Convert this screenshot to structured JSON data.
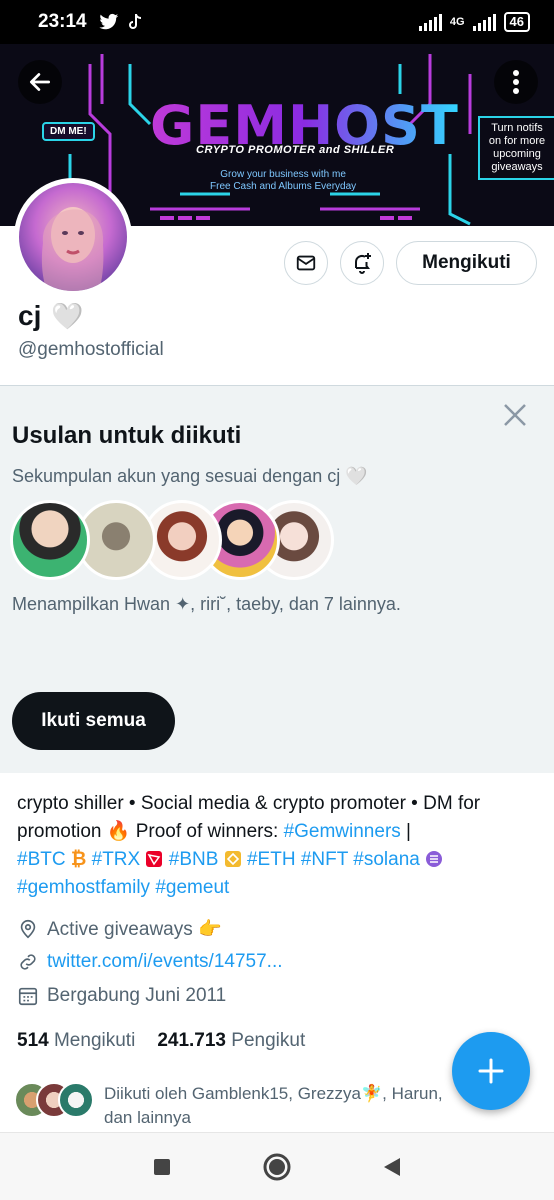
{
  "status_bar": {
    "time": "23:14",
    "network": "4G",
    "battery": "46",
    "notification_icons": [
      "twitter-icon",
      "tiktok-icon"
    ]
  },
  "banner": {
    "title": "GEMHOST",
    "subtitle": "CRYPTO PROMOTER and SHILLER",
    "tagline_line1": "Grow your business with me",
    "tagline_line2": "Free Cash and Albums Everyday",
    "dm_badge": "DM ME!",
    "notifs_text": "Turn notifs on for more upcoming giveaways"
  },
  "profile": {
    "display_name": "cj",
    "name_emoji": "🤍",
    "handle": "@gemhostofficial",
    "follow_label": "Mengikuti"
  },
  "suggestions": {
    "title": "Usulan untuk diikuti",
    "subtitle": "Sekumpulan akun yang sesuai dengan cj 🤍",
    "showing": "Menampilkan Hwan ✦, riri˘, taeby, dan 7 lainnya.",
    "follow_all_label": "Ikuti semua"
  },
  "bio": {
    "part1": "crypto shiller • Social media & crypto promoter • DM for promotion 🔥 Proof of winners: ",
    "tag_gemwinners": "#Gemwinners",
    "sep": " |",
    "tag_btc": "#BTC",
    "tag_trx": "#TRX",
    "tag_bnb": "#BNB",
    "tag_eth": "#ETH",
    "tag_nft": "#NFT",
    "tag_solana": "#solana",
    "tag_gemhostfamily": "#gemhostfamily",
    "tag_gemeut": "#gemeut"
  },
  "meta": {
    "location": "Active giveaways 👉",
    "link": "twitter.com/i/events/14757...",
    "joined": "Bergabung Juni 2011"
  },
  "counts": {
    "following_num": "514",
    "following_label": "Mengikuti",
    "followers_num": "241.713",
    "followers_label": "Pengikut"
  },
  "followed_by": {
    "text": "Diikuti oleh Gamblenk15, Grezzya🧚, Harun, dan lainnya"
  },
  "colors": {
    "accent": "#1d9bf0",
    "text": "#0f1419",
    "muted": "#536471",
    "panel": "#eff3f4"
  }
}
